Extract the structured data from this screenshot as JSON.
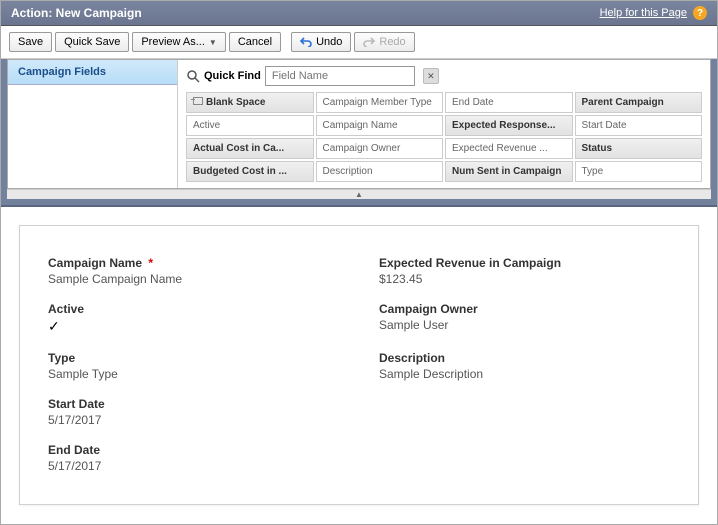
{
  "header": {
    "title": "Action: New Campaign",
    "help_label": "Help for this Page"
  },
  "toolbar": {
    "save": "Save",
    "quick_save": "Quick Save",
    "preview_as": "Preview As...",
    "cancel": "Cancel",
    "undo": "Undo",
    "redo": "Redo"
  },
  "palette": {
    "sidebar_label": "Campaign Fields",
    "quickfind_label": "Quick Find",
    "quickfind_placeholder": "Field Name",
    "fields": [
      {
        "label": "Blank Space",
        "used": true,
        "blank": true
      },
      {
        "label": "Campaign Member Type",
        "used": false
      },
      {
        "label": "End Date",
        "used": false
      },
      {
        "label": "Parent Campaign",
        "used": true
      },
      {
        "label": "Active",
        "used": false
      },
      {
        "label": "Campaign Name",
        "used": false
      },
      {
        "label": "Expected Response...",
        "used": true
      },
      {
        "label": "Start Date",
        "used": false
      },
      {
        "label": "Actual Cost in Ca...",
        "used": true
      },
      {
        "label": "Campaign Owner",
        "used": false
      },
      {
        "label": "Expected Revenue ...",
        "used": false
      },
      {
        "label": "Status",
        "used": true
      },
      {
        "label": "Budgeted Cost in ...",
        "used": true
      },
      {
        "label": "Description",
        "used": false
      },
      {
        "label": "Num Sent in Campaign",
        "used": true
      },
      {
        "label": "Type",
        "used": false
      }
    ]
  },
  "canvas": {
    "left": [
      {
        "label": "Campaign Name",
        "value": "Sample Campaign Name",
        "required": true
      },
      {
        "label": "Active",
        "value": "",
        "check": true
      },
      {
        "label": "Type",
        "value": "Sample Type"
      },
      {
        "label": "Start Date",
        "value": "5/17/2017"
      },
      {
        "label": "End Date",
        "value": "5/17/2017"
      }
    ],
    "right": [
      {
        "label": "Expected Revenue in Campaign",
        "value": "$123.45"
      },
      {
        "label": "Campaign Owner",
        "value": "Sample User"
      },
      {
        "label": "Description",
        "value": "Sample Description"
      }
    ]
  }
}
